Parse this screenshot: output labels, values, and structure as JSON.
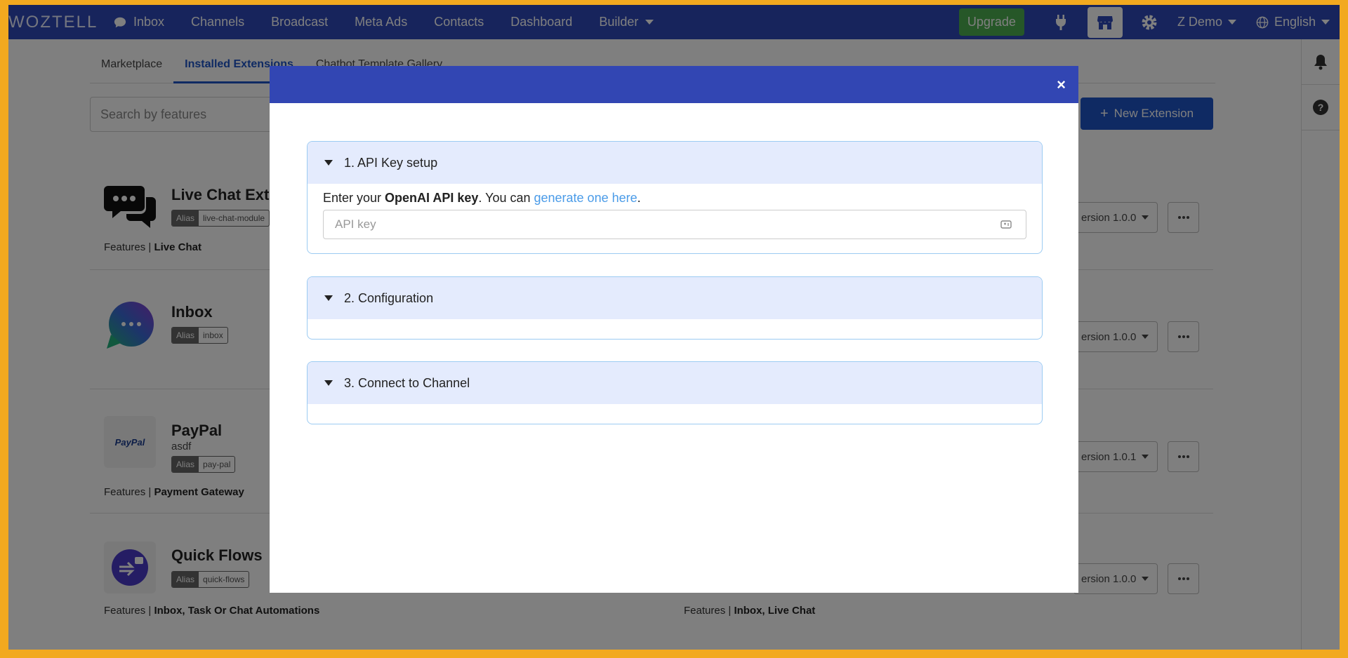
{
  "nav": {
    "logo": "WOZTELL",
    "items": [
      {
        "label": "Inbox"
      },
      {
        "label": "Channels"
      },
      {
        "label": "Broadcast"
      },
      {
        "label": "Meta Ads"
      },
      {
        "label": "Contacts"
      },
      {
        "label": "Dashboard"
      },
      {
        "label": "Builder"
      }
    ],
    "upgrade": "Upgrade",
    "account": "Z Demo",
    "language": "English"
  },
  "tabs": [
    "Marketplace",
    "Installed Extensions",
    "Chatbot Template Gallery"
  ],
  "search": {
    "placeholder": "Search by features"
  },
  "new_extension": "New Extension",
  "extensions": [
    {
      "name": "Live Chat Ext",
      "alias_key": "Alias",
      "alias": "live-chat-module",
      "features_label": "Features |",
      "features": "Live Chat",
      "version": "ersion 1.0.0"
    },
    {
      "name": "Inbox",
      "alias_key": "Alias",
      "alias": "inbox",
      "version": "ersion 1.0.0"
    },
    {
      "name": "PayPal",
      "sub": "asdf",
      "alias_key": "Alias",
      "alias": "pay-pal",
      "features_label": "Features |",
      "features": "Payment Gateway",
      "version": "ersion 1.0.1",
      "logo_text": "PayPal"
    },
    {
      "name": "Quick Flows",
      "alias_key": "Alias",
      "alias": "quick-flows",
      "features_label": "Features |",
      "features": "Inbox, Task Or Chat Automations",
      "version": "ersion 1.0.0"
    }
  ],
  "extra_features": {
    "label": "Features |",
    "value": "Inbox, Live Chat"
  },
  "modal": {
    "close": "×",
    "panels": [
      {
        "title": "1. API Key setup"
      },
      {
        "title": "2. Configuration"
      },
      {
        "title": "3. Connect to Channel"
      }
    ],
    "api": {
      "text_before": "Enter your ",
      "bold": "OpenAI API key",
      "text_mid": ". You can ",
      "link": "generate one here",
      "text_after": ".",
      "placeholder": "API key"
    }
  }
}
